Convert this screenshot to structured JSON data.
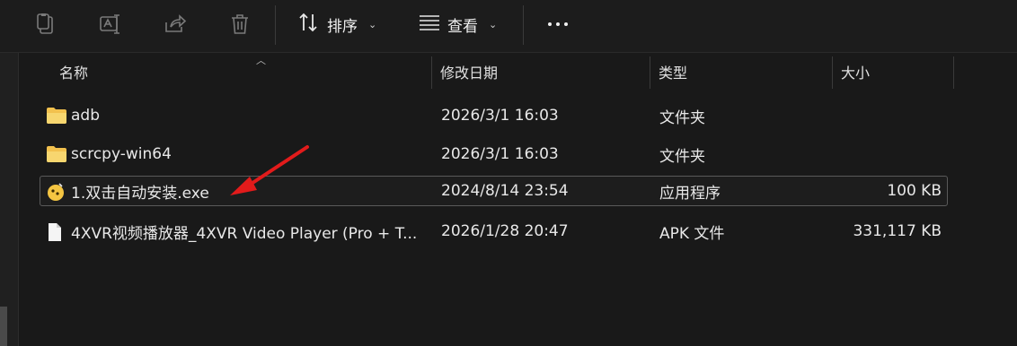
{
  "toolbar": {
    "copy_icon": "copy-icon",
    "rename_icon": "rename-icon",
    "share_icon": "share-icon",
    "delete_icon": "delete-icon",
    "sort_label": "排序",
    "view_label": "查看",
    "more_icon": "more-icon"
  },
  "columns": {
    "name": "名称",
    "modified": "修改日期",
    "type": "类型",
    "size": "大小"
  },
  "files": [
    {
      "name": "adb",
      "date": "2026/3/1 16:03",
      "type": "文件夹",
      "size": "",
      "icon": "folder-icon"
    },
    {
      "name": "scrcpy-win64",
      "date": "2026/3/1 16:03",
      "type": "文件夹",
      "size": "",
      "icon": "folder-icon"
    },
    {
      "name": "1.双击自动安装.exe",
      "date": "2024/8/14 23:54",
      "type": "应用程序",
      "size": "100 KB",
      "icon": "app-icon",
      "selected": true
    },
    {
      "name": "4XVR视频播放器_4XVR Video Player (Pro + T...",
      "date": "2026/1/28 20:47",
      "type": "APK 文件",
      "size": "331,117 KB",
      "icon": "document-icon"
    }
  ],
  "colors": {
    "background": "#191919",
    "folder": "#f2c14e",
    "arrow": "#e21b1b",
    "selection_border": "#5a5a5a"
  }
}
